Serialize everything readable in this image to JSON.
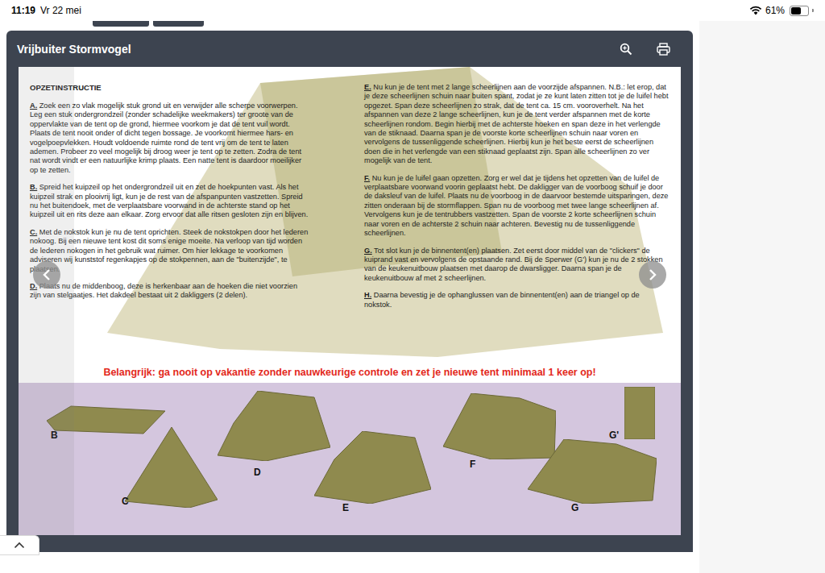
{
  "status_bar": {
    "time": "11:19",
    "date": "Vr 22 mei",
    "battery": "61%",
    "battery_level": 0.61,
    "wifi": true
  },
  "window": {
    "title": "Vrijbuiter Stormvogel"
  },
  "document": {
    "heading": "OPZETINSTRUCTIE",
    "columns": [
      [
        {
          "letter": "A.",
          "text": "Zoek een zo vlak mogelijk stuk grond uit en verwijder alle scherpe voorwerpen. Leg een stuk ondergrondzeil (zonder schadelijke weekmakers) ter groote van de oppervlakte van de tent op de grond, hiermee voorkom je dat de tent vuil wordt. Plaats de tent nooit onder of dicht tegen bossage. Je voorkomt hiermee hars- en vogelpoepvlekken. Houdt voldoende ruimte rond de tent vrij om de tent te laten ademen. Probeer zo veel mogelijk bij droog weer je tent op te zetten. Zodra de tent nat wordt vindt er een natuurlijke krimp plaats. Een natte tent is daardoor moeilijker op te zetten."
        },
        {
          "letter": "B.",
          "text": "Spreid het kuipzeil op het ondergrondzeil uit en zet de hoekpunten vast. Als het kuipzeil strak en plooivrij ligt, kun je de rest van de afspanpunten vastzetten. Spreid nu het buitendoek, met de verplaatsbare voorwand in de achterste stand op het kuipzeil uit en rits deze aan elkaar. Zorg ervoor dat alle ritsen gesloten zijn en blijven."
        },
        {
          "letter": "C.",
          "text": "Met de nokstok kun je nu de tent oprichten. Steek de nokstokpen door het lederen nokoog. Bij een nieuwe tent kost dit soms enige moeite. Na verloop van tijd worden de lederen nokogen in het gebruik wat ruimer. Om hier lekkage te voorkomen adviseren wij kunststof regenkapjes op de stokpennen, aan de \"buitenzijde\", te plaatsen."
        },
        {
          "letter": "D.",
          "text": "Plaats nu de middenboog, deze is herkenbaar aan de hoeken die niet voorzien zijn van stelgaatjes. Het dakdeel bestaat uit 2 dakliggers (2 delen)."
        }
      ],
      [
        {
          "letter": "E.",
          "text": "Nu kun je de tent met 2 lange scheerlijnen aan de voorzijde afspannen. N.B.: let erop, dat je deze scheerlijnen schuin naar buiten spant, zodat je ze kunt laten zitten tot je de luifel hebt opgezet. Span deze scheerlijnen zo strak, dat de tent ca. 15 cm. vooroverhelt. Na het afspannen van deze 2 lange scheerlijnen, kun je de tent verder afspannen met de korte scheerlijnen rondom. Begin hierbij met de achterste hoeken en span deze in het verlengde van de stiknaad. Daarna span je de voorste korte scheerlijnen schuin naar voren en vervolgens de tussenliggende scheerlijnen. Hierbij kun je het beste eerst de scheerlijnen doen die in het verlengde van een stiknaad geplaatst zijn. Span alle scheerlijnen zo ver mogelijk van de tent."
        },
        {
          "letter": "F.",
          "text": "Nu kun je de luifel gaan opzetten. Zorg er wel dat je tijdens het opzetten van de luifel de verplaatsbare voorwand voorin geplaatst hebt. De dakligger van de voorboog schuif je door de daksleuf van de luifel. Plaats nu de voorboog in de daarvoor bestemde uitsparingen, deze zitten onderaan bij de stormflappen. Span nu de voorboog met twee lange scheerlijnen af. Vervolgens kun je de tentrubbers vastzetten. Span de voorste 2 korte scheerlijnen schuin naar voren en de achterste 2 schuin naar achteren. Bevestig nu de tussenliggende scheerlijnen."
        },
        {
          "letter": "G.",
          "text": "Tot slot kun je de binnentent(en) plaatsen. Zet eerst door middel van de \"clickers\" de kuiprand vast en vervolgens de opstaande rand. Bij de Sperwer (G') kun je nu de 2 stokken van de keukenuitbouw plaatsen met daarop de dwarsligger. Daarna span je de keukenuitbouw af met 2 scheerlijnen."
        },
        {
          "letter": "H.",
          "text": "Daarna bevestig je de ophanglussen van de binnentent(en) aan de triangel op de nokstok."
        }
      ]
    ],
    "warning": "Belangrijk: ga nooit op vakantie zonder nauwkeurige controle en zet je nieuwe tent minimaal 1 keer op!",
    "figures": [
      {
        "label": "B"
      },
      {
        "label": "C"
      },
      {
        "label": "D"
      },
      {
        "label": "E"
      },
      {
        "label": "F"
      },
      {
        "label": "G"
      },
      {
        "label": "G'"
      }
    ]
  }
}
